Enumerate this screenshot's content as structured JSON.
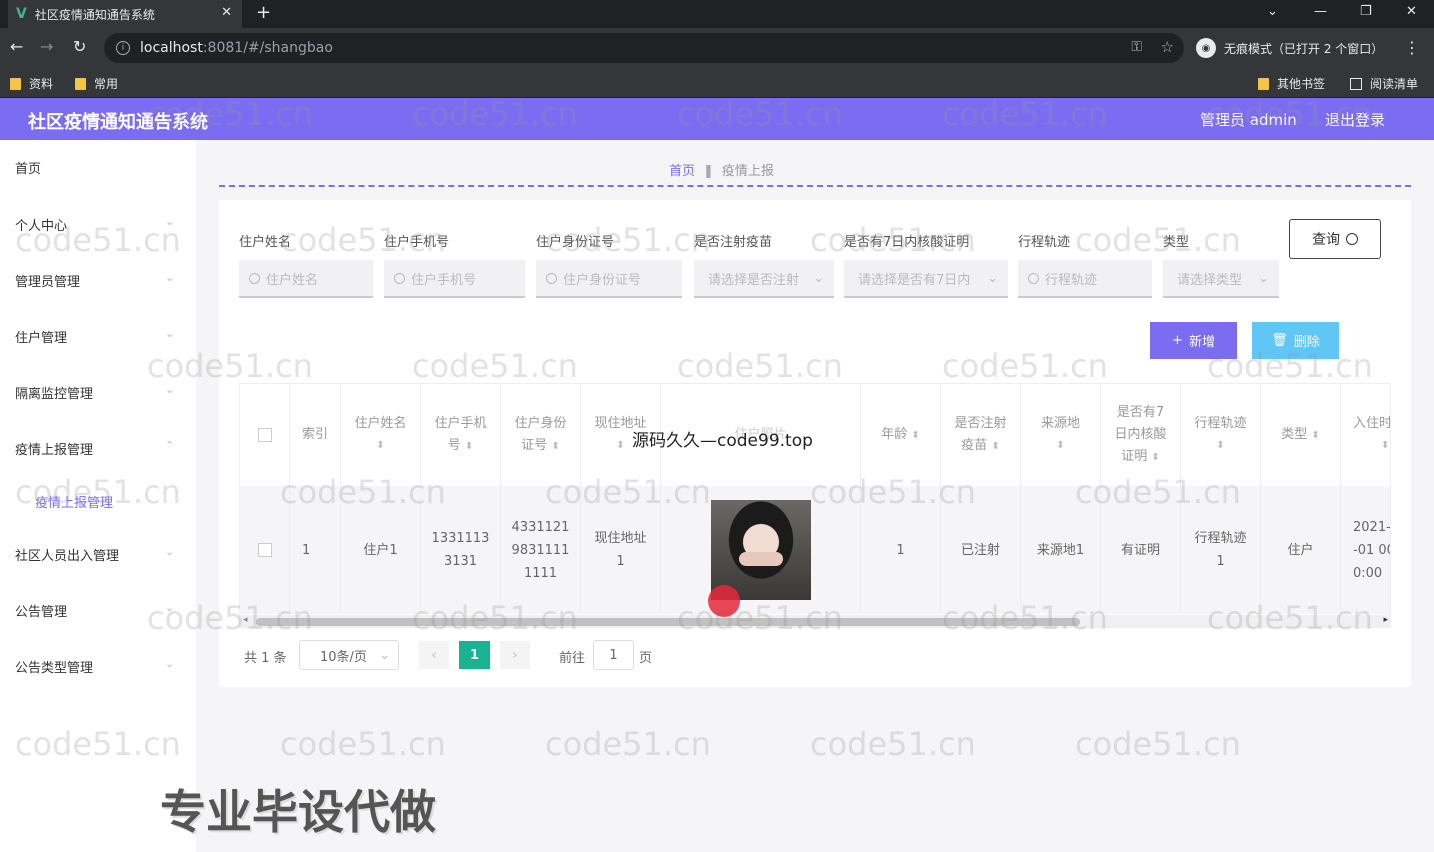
{
  "browser": {
    "tab_title": "社区疫情通知通告系统",
    "url_host": "localhost",
    "url_port_path": ":8081/#/shangbao",
    "incognito_label": "无痕模式（已打开 2 个窗口）",
    "bookmarks": [
      "资料",
      "常用"
    ],
    "other_bookmarks": "其他书签",
    "reading_list": "阅读清单"
  },
  "header": {
    "title": "社区疫情通知通告系统",
    "admin": "管理员 admin",
    "logout": "退出登录"
  },
  "sidebar": {
    "items": [
      "首页",
      "个人中心",
      "管理员管理",
      "住户管理",
      "隔离监控管理",
      "疫情上报管理",
      "社区人员出入管理",
      "公告管理",
      "公告类型管理"
    ],
    "sub_item": "疫情上报管理"
  },
  "breadcrumb": {
    "home": "首页",
    "current": "疫情上报"
  },
  "filters": [
    {
      "label": "住户姓名",
      "placeholder": "住户姓名"
    },
    {
      "label": "住户手机号",
      "placeholder": "住户手机号"
    },
    {
      "label": "住户身份证号",
      "placeholder": "住户身份证号"
    },
    {
      "label": "是否注射疫苗",
      "placeholder": "请选择是否注射"
    },
    {
      "label": "是否有7日内核酸证明",
      "placeholder": "请选择是否有7日内"
    },
    {
      "label": "行程轨迹",
      "placeholder": "行程轨迹"
    },
    {
      "label": "类型",
      "placeholder": "请选择类型"
    }
  ],
  "buttons": {
    "query": "查询",
    "add": "新增",
    "delete": "删除"
  },
  "table": {
    "headers": [
      "索引",
      "住户姓名",
      "住户手机号",
      "住户身份证号",
      "现住地址",
      "住户照片",
      "年龄",
      "是否注射疫苗",
      "来源地",
      "是否有7日内核酸证明",
      "行程轨迹",
      "类型",
      "入住时间"
    ],
    "header_lines": {
      "name": [
        "住户姓名"
      ],
      "phone": [
        "住户手机",
        "号"
      ],
      "idcard": [
        "住户身份",
        "证号"
      ],
      "address": [
        "现住地址"
      ],
      "photo": [
        "住户照片"
      ],
      "age": [
        "年龄"
      ],
      "vaccine": [
        "是否注射",
        "疫苗"
      ],
      "origin": [
        "来源地"
      ],
      "nucleic": [
        "是否有7",
        "日内核酸",
        "证明"
      ],
      "trace": [
        "行程轨迹"
      ],
      "type": [
        "类型"
      ],
      "time": [
        "入住时"
      ]
    },
    "row": {
      "index": "1",
      "name": "住户1",
      "phone_lines": [
        "1331113",
        "3131"
      ],
      "id_lines": [
        "4331121",
        "9831111",
        "1111"
      ],
      "address_lines": [
        "现住地址",
        "1"
      ],
      "age": "1",
      "vaccine": "已注射",
      "origin": "来源地1",
      "nucleic": "有证明",
      "trace_lines": [
        "行程轨迹",
        "1"
      ],
      "type": "住户",
      "time_lines": [
        "2021-",
        "-01 00",
        "0:00"
      ]
    }
  },
  "pagination": {
    "total": "共 1 条",
    "page_size": "10条/页",
    "current": "1",
    "goto_prefix": "前往",
    "goto_value": "1",
    "goto_suffix": "页"
  },
  "watermark": "code51.cn",
  "overlays": {
    "source": "源码久久—code99.top",
    "promo": "专业毕设代做"
  }
}
